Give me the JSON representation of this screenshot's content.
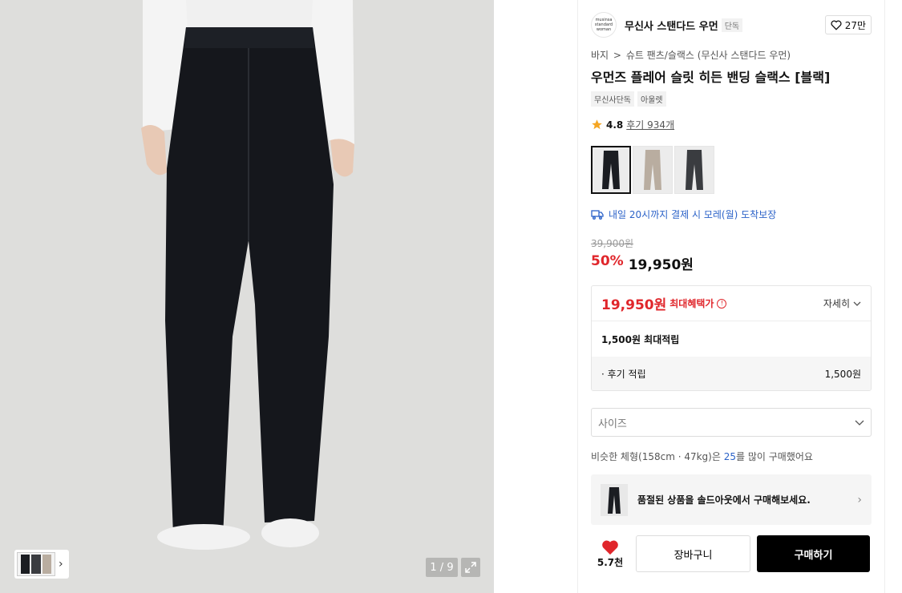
{
  "gallery": {
    "counter": "1 / 9",
    "thumb_arrow": "›"
  },
  "brand": {
    "logo_text": "musinsa standard woman",
    "name": "무신사 스탠다드 우먼",
    "tag": "단독",
    "like_count": "27만"
  },
  "breadcrumb": {
    "category": "바지",
    "separator": ">",
    "subcategory": "슈트 팬츠/슬랙스 (무신사 스탠다드 우먼)"
  },
  "product": {
    "title": "우먼즈 플레어 슬릿 히든 밴딩 슬랙스 [블랙]",
    "badges": [
      "무신사단독",
      "아울렛"
    ],
    "rating": "4.8",
    "review_link": "후기 934개",
    "colors": [
      "#1b1d22",
      "#b9ada0",
      "#3a3c40"
    ]
  },
  "delivery": {
    "text": "내일 20시까지 결제 시 모레(월) 도착보장"
  },
  "price": {
    "original": "39,900원",
    "discount": "50%",
    "sale": "19,950원"
  },
  "benefit": {
    "max_price": "19,950원",
    "max_label": "최대혜택가",
    "info_icon": "!",
    "detail": "자세히",
    "points_summary": "1,500원 최대적립",
    "review_points_label": "· 후기 적립",
    "review_points_value": "1,500원"
  },
  "size_select": {
    "placeholder": "사이즈"
  },
  "similar": {
    "prefix": "비슷한 체형(158cm · 47kg)은 ",
    "size": "25",
    "suffix": "를 많이 구매했어요"
  },
  "soldout": {
    "text": "품절된 상품을 솔드아웃에서 구매해보세요.",
    "arrow": "›"
  },
  "actions": {
    "fav_count": "5.7천",
    "cart_label": "장바구니",
    "buy_label": "구매하기"
  },
  "colors_theme": {
    "accent_red": "#e0262b",
    "link_blue": "#2b62c8"
  }
}
